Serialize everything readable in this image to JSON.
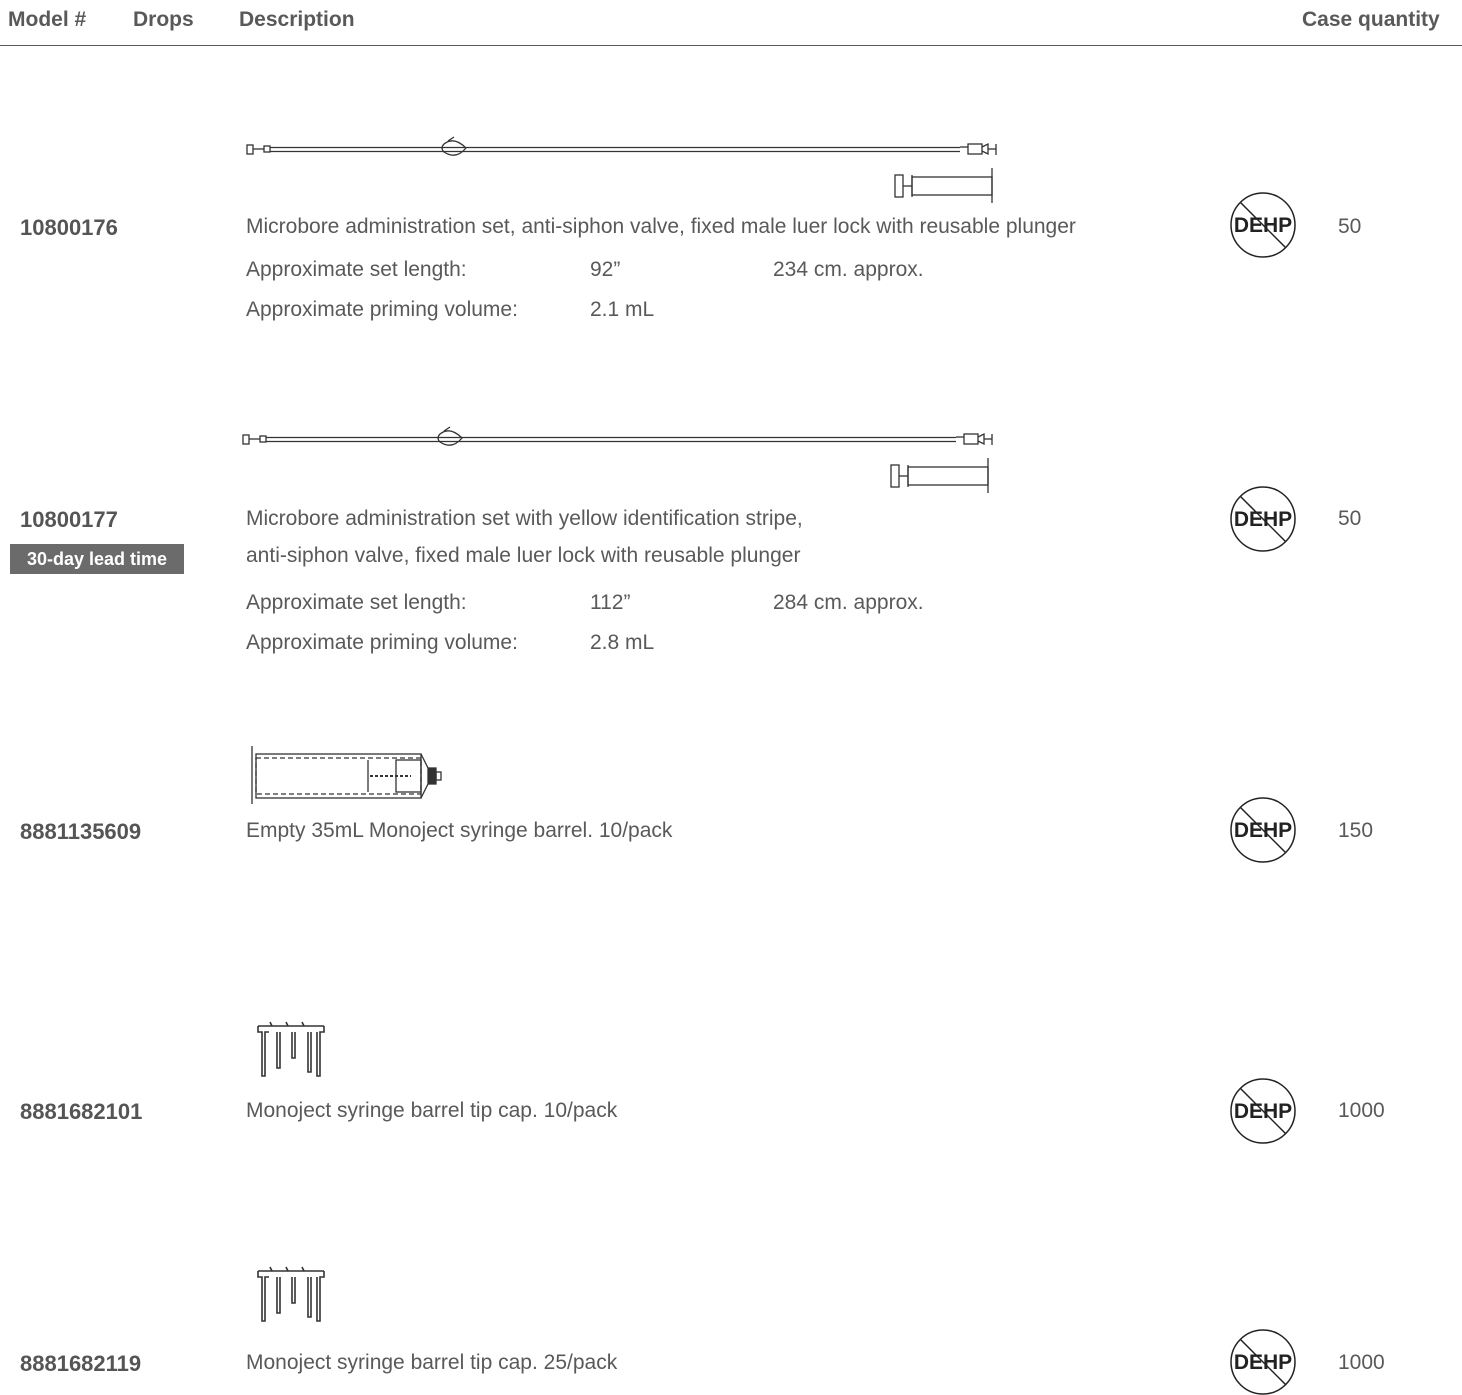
{
  "header": {
    "model": "Model #",
    "drops": "Drops",
    "description": "Description",
    "case_quantity": "Case quantity"
  },
  "dehp_badge": "DEHP",
  "products": [
    {
      "model": "10800176",
      "description_lines": [
        "Microbore administration set, anti-siphon valve, fixed male luer lock with reusable plunger"
      ],
      "set_length_label": "Approximate set length:",
      "set_length_in": "92”",
      "set_length_cm": "234 cm. approx.",
      "priming_label": "Approximate priming volume:",
      "priming_value": "2.1 mL",
      "case_quantity": "50"
    },
    {
      "model": "10800177",
      "badge": "30-day lead time",
      "description_lines": [
        "Microbore administration set with yellow identification stripe,",
        "anti-siphon valve, fixed male luer lock with reusable plunger"
      ],
      "set_length_label": "Approximate set length:",
      "set_length_in": "112”",
      "set_length_cm": "284 cm. approx.",
      "priming_label": "Approximate priming volume:",
      "priming_value": "2.8 mL",
      "case_quantity": "50"
    },
    {
      "model": "8881135609",
      "description_lines": [
        "Empty 35mL Monoject syringe barrel. 10/pack"
      ],
      "case_quantity": "150"
    },
    {
      "model": "8881682101",
      "description_lines": [
        "Monoject syringe barrel tip cap. 10/pack"
      ],
      "case_quantity": "1000"
    },
    {
      "model": "8881682119",
      "description_lines": [
        "Monoject syringe barrel tip cap. 25/pack"
      ],
      "case_quantity": "1000"
    }
  ]
}
